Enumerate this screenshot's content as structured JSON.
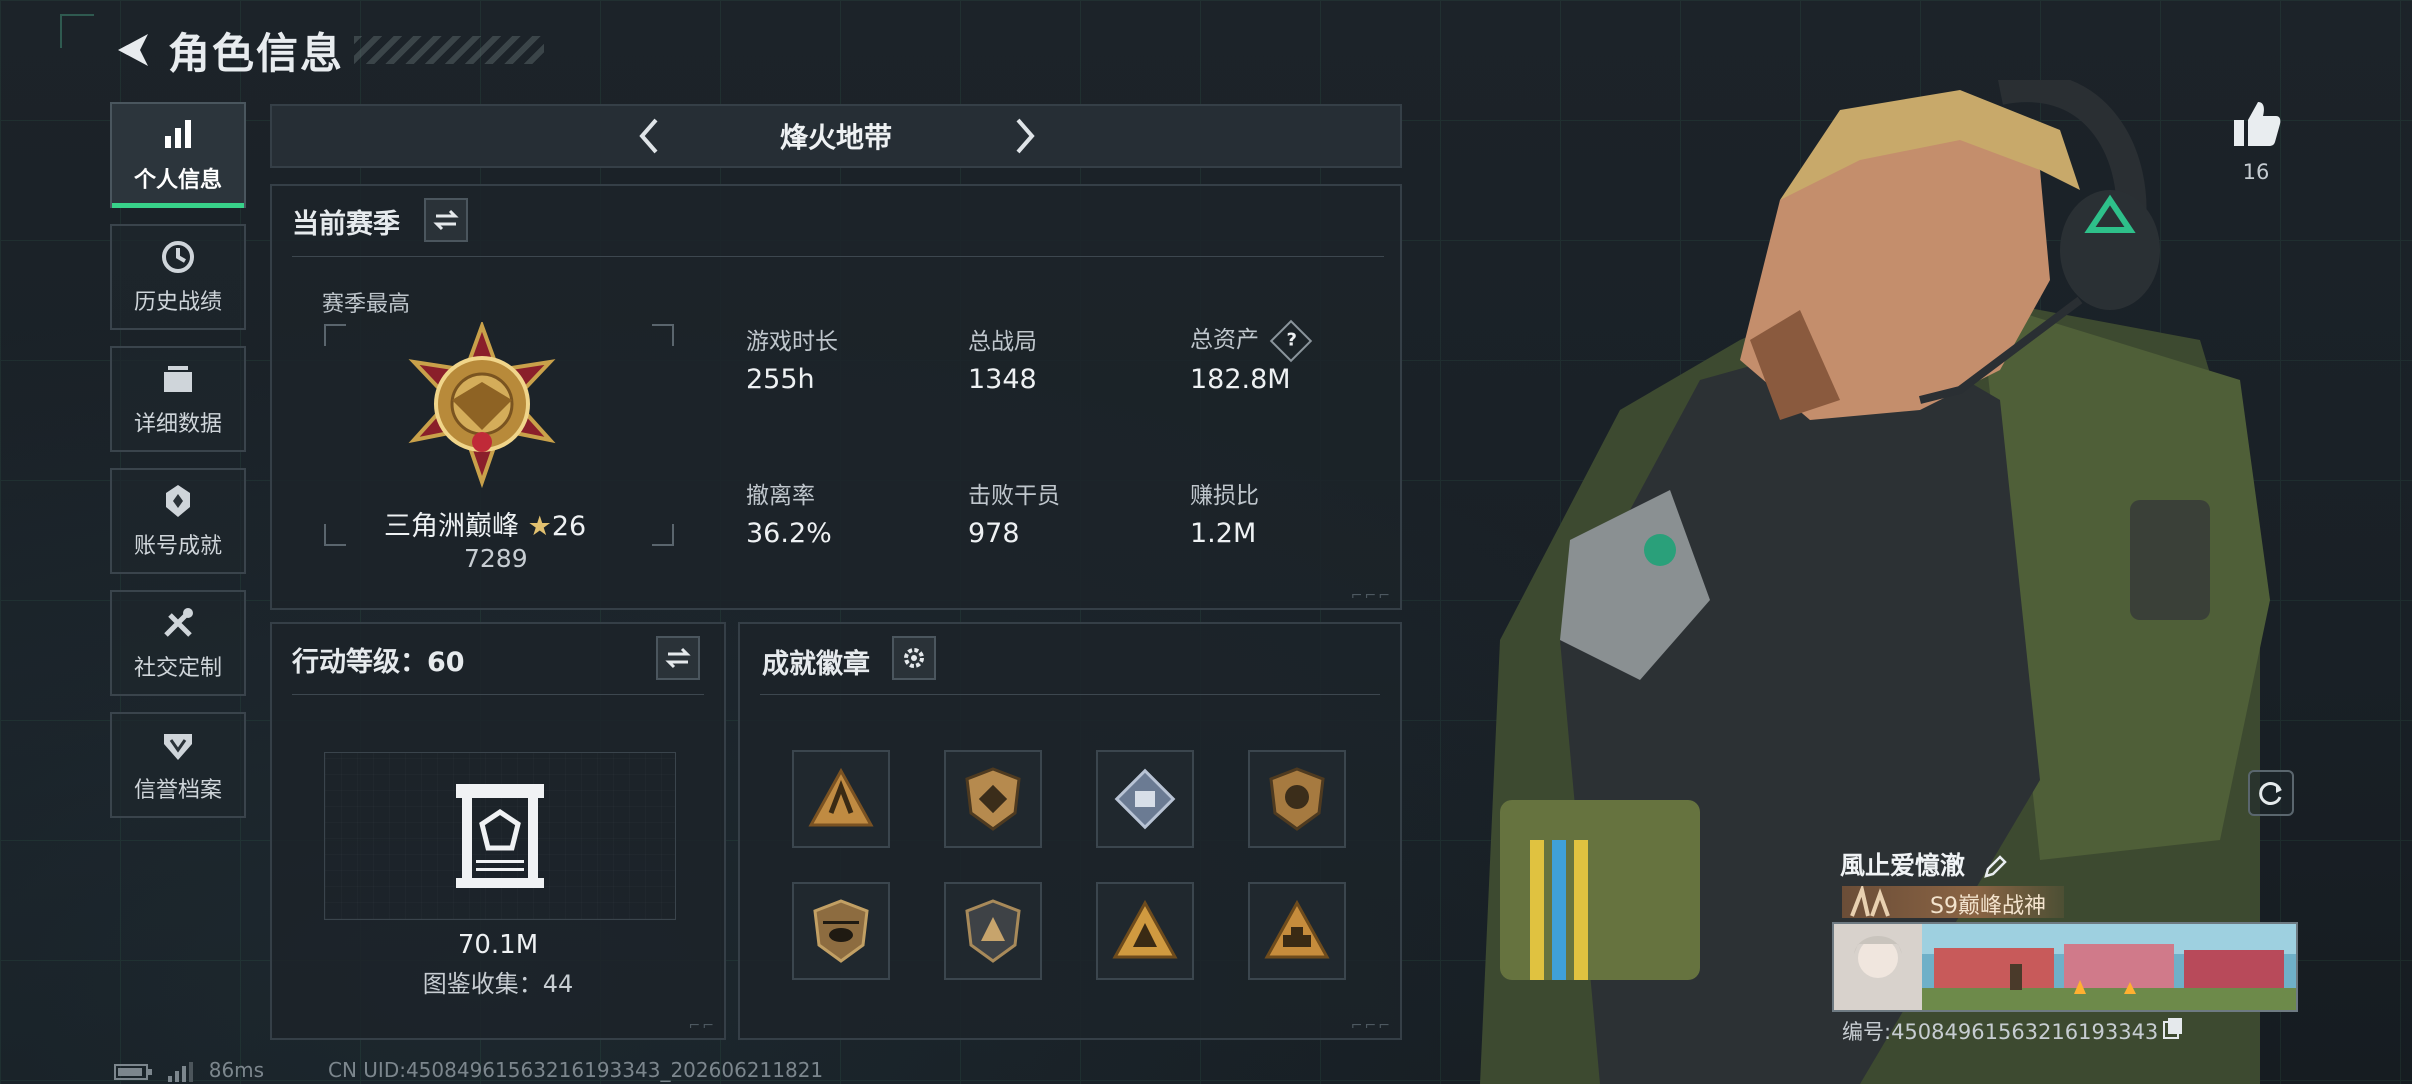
{
  "header": {
    "title": "角色信息"
  },
  "sidebar": {
    "items": [
      {
        "label": "个人信息",
        "icon": "bar-chart-icon"
      },
      {
        "label": "历史战绩",
        "icon": "history-icon"
      },
      {
        "label": "详细数据",
        "icon": "folder-icon"
      },
      {
        "label": "账号成就",
        "icon": "achievement-icon"
      },
      {
        "label": "社交定制",
        "icon": "tools-icon"
      },
      {
        "label": "信誉档案",
        "icon": "credit-icon"
      }
    ]
  },
  "mode_tab": {
    "label": "烽火地带"
  },
  "season": {
    "title": "当前赛季",
    "best_label": "赛季最高",
    "rank_name": "三角洲巅峰",
    "rank_stars": "26",
    "rank_points": "7289",
    "stats": [
      {
        "label": "游戏时长",
        "value": "255h"
      },
      {
        "label": "总战局",
        "value": "1348"
      },
      {
        "label": "总资产",
        "value": "182.8M",
        "help": "?"
      },
      {
        "label": "撤离率",
        "value": "36.2%"
      },
      {
        "label": "击败干员",
        "value": "978"
      },
      {
        "label": "赚损比",
        "value": "1.2M"
      }
    ]
  },
  "action_level": {
    "title": "行动等级：60",
    "value": "70.1M",
    "collection": "图鉴收集：44"
  },
  "achievements": {
    "title": "成就徽章",
    "badges": [
      "badge-1",
      "badge-2",
      "badge-3",
      "badge-4",
      "badge-5",
      "badge-6",
      "badge-7",
      "badge-8"
    ]
  },
  "profile": {
    "likes": "16",
    "player_name": "風止爱憶澈",
    "rank_title": "S9巅峰战神",
    "id_line": "编号:4508496156321619334​3"
  },
  "status_bar": {
    "ping": "86ms",
    "cn_uid": "CN UID:4508496156321619334​3_202606211821"
  },
  "colors": {
    "accent": "#38d28a",
    "panel": "#1c2329",
    "gold": "#c9a14a"
  }
}
